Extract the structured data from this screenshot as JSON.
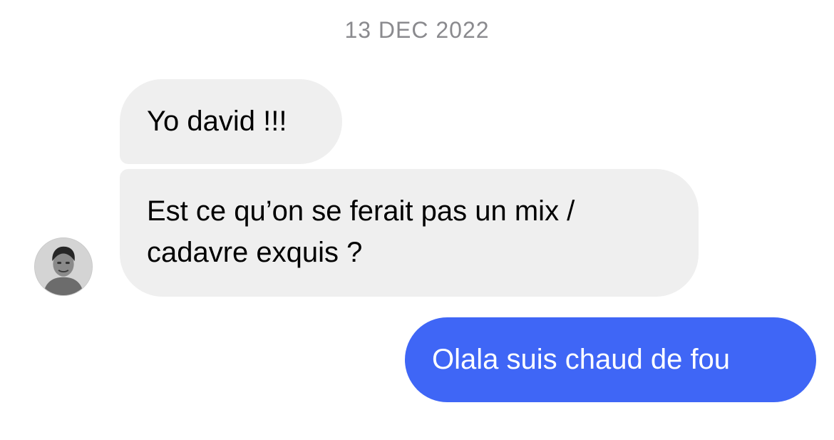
{
  "conversation": {
    "date": "13 DEC 2022",
    "messages": [
      {
        "direction": "incoming",
        "text": "Yo david !!!"
      },
      {
        "direction": "incoming",
        "text": "Est ce qu’on se ferait pas un mix / cadavre exquis ?"
      },
      {
        "direction": "outgoing",
        "text": "Olala suis chaud de fou"
      }
    ]
  },
  "contact": {
    "avatar_icon": "user-avatar-photo"
  },
  "colors": {
    "incoming_bubble": "#efefef",
    "outgoing_bubble": "#3f66f6",
    "date_text": "#8a8a8e"
  }
}
